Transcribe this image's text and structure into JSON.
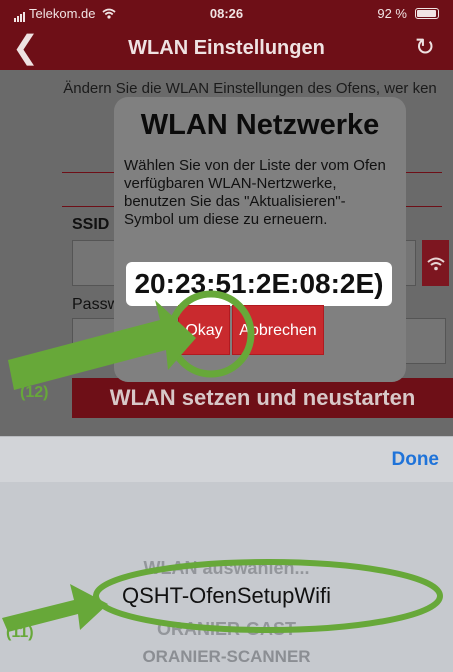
{
  "status_bar": {
    "carrier": "Telekom.de",
    "time": "08:26",
    "battery": "92 %"
  },
  "nav": {
    "title": "WLAN Einstellungen"
  },
  "background_form": {
    "intro_text": "Ändern Sie die WLAN Einstellungen des Ofens, wer ken werd auch die ert.",
    "ssid_label": "SSID",
    "password_label": "Passw",
    "submit_label": "WLAN setzen und neustarten"
  },
  "dialog": {
    "title": "WLAN Netzwerke",
    "message": "Wählen Sie von der Liste der vom Ofen verfügbaren WLAN-Nertzwerke, benutzen Sie das \"Aktualisieren\"-Symbol um diese zu erneuern.",
    "mac_value": "20:23:51:2E:08:2E)",
    "okay_label": "Okay",
    "cancel_label": "Abbrechen"
  },
  "picker": {
    "done_label": "Done",
    "options": [
      "WLAN auswählen...",
      "QSHT-OfenSetupWifi",
      "ORANIER-GAST",
      "ORANIER-SCANNER"
    ],
    "selected": "QSHT-OfenSetupWifi"
  },
  "annotations": {
    "step_okay": "(12)",
    "step_select": "(11)",
    "color": "#67a839"
  },
  "colors": {
    "brand": "#6e0f17",
    "button_red": "#c92a2e",
    "link_blue": "#1f73d9"
  }
}
